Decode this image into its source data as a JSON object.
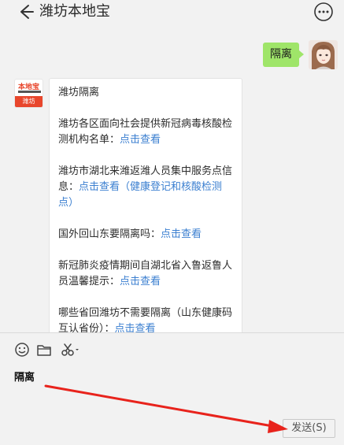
{
  "header": {
    "title": "潍坊本地宝",
    "back_icon": "back-arrow-icon",
    "more_icon": "more-dots-icon"
  },
  "chat": {
    "self_message": "隔离",
    "bot_avatar": {
      "logo_text": "本地宝",
      "logo_sub": "潍坊"
    },
    "bot_message": {
      "title": "潍坊隔离",
      "items": [
        {
          "text": "潍坊各区面向社会提供新冠病毒核酸检测机构名单：",
          "link": "点击查看"
        },
        {
          "text": "潍坊市湖北来潍返潍人员集中服务点信息：",
          "link": "点击查看（健康登记和核酸检测点）"
        },
        {
          "text": "国外回山东要隔离吗：",
          "link": "点击查看"
        },
        {
          "text": "新冠肺炎疫情期间自湖北省入鲁返鲁人员温馨提示：",
          "link": "点击查看"
        },
        {
          "text": "哪些省回潍坊不需要隔离（山东健康码互认省份）：",
          "link": "点击查看"
        }
      ]
    }
  },
  "input": {
    "text": "隔离",
    "send_label": "发送(S)",
    "tools": [
      "emoji-icon",
      "folder-icon",
      "scissors-icon"
    ]
  },
  "colors": {
    "self_bubble": "#9fe569",
    "link": "#3b7fd0",
    "arrow": "#e8231c",
    "logo": "#e8462c"
  }
}
